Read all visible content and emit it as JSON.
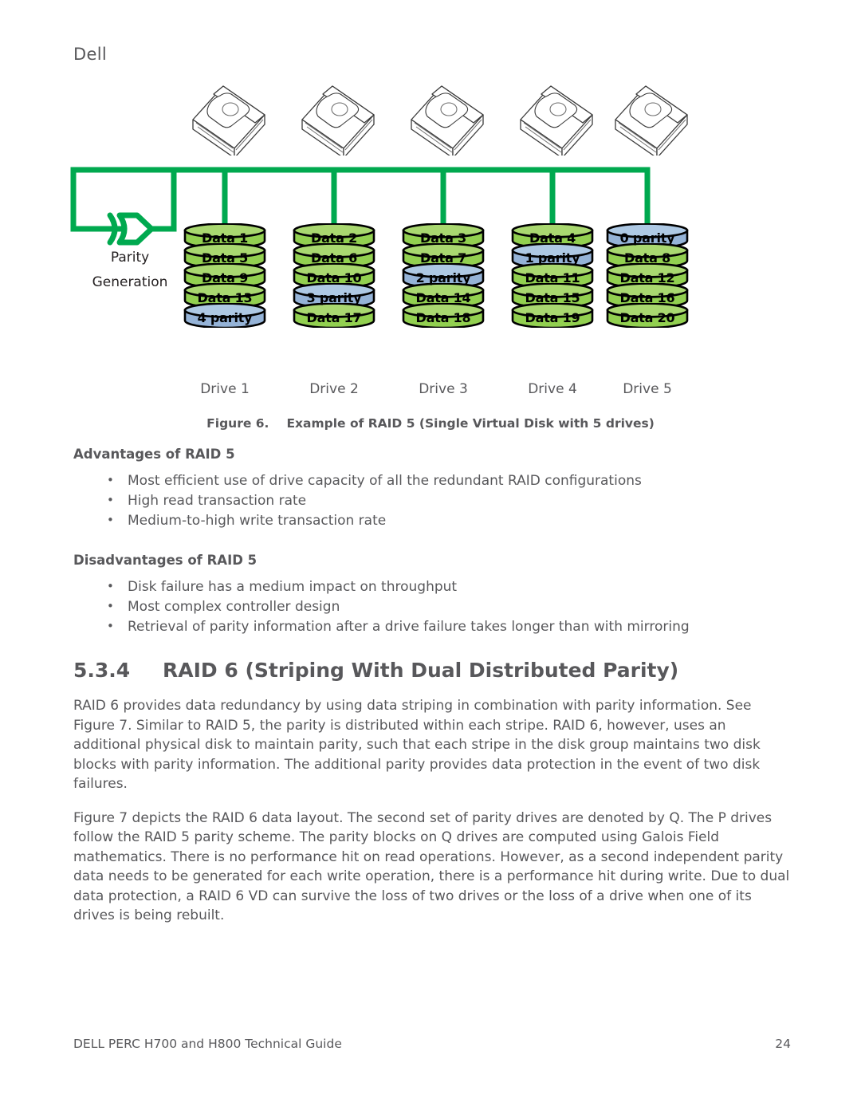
{
  "header": {
    "logo_text": "Dell"
  },
  "figure": {
    "caption_number": "Figure 6.",
    "caption_text": "Example of RAID 5 (Single Virtual Disk with 5 drives)",
    "parity_label_line1": "Parity",
    "parity_label_line2": "Generation",
    "colors": {
      "green_block": "#92D050",
      "green_top": "#A9D870",
      "blue_block": "#95B3D7",
      "blue_top": "#AEC9E4",
      "bus_line": "#00A94F",
      "outline": "#000000"
    },
    "drives": [
      {
        "label": "Drive 1",
        "blocks": [
          {
            "text": "Data 1",
            "kind": "data"
          },
          {
            "text": "Data 5",
            "kind": "data"
          },
          {
            "text": "Data 9",
            "kind": "data"
          },
          {
            "text": "Data 13",
            "kind": "data"
          },
          {
            "text": "4 parity",
            "kind": "parity"
          }
        ]
      },
      {
        "label": "Drive 2",
        "blocks": [
          {
            "text": "Data 2",
            "kind": "data"
          },
          {
            "text": "Data 6",
            "kind": "data"
          },
          {
            "text": "Data 10",
            "kind": "data"
          },
          {
            "text": "3 parity",
            "kind": "parity"
          },
          {
            "text": "Data 17",
            "kind": "data"
          }
        ]
      },
      {
        "label": "Drive 3",
        "blocks": [
          {
            "text": "Data 3",
            "kind": "data"
          },
          {
            "text": "Data 7",
            "kind": "data"
          },
          {
            "text": "2 parity",
            "kind": "parity"
          },
          {
            "text": "Data 14",
            "kind": "data"
          },
          {
            "text": "Data 18",
            "kind": "data"
          }
        ]
      },
      {
        "label": "Drive 4",
        "blocks": [
          {
            "text": "Data 4",
            "kind": "data"
          },
          {
            "text": "1 parity",
            "kind": "parity"
          },
          {
            "text": "Data 11",
            "kind": "data"
          },
          {
            "text": "Data 15",
            "kind": "data"
          },
          {
            "text": "Data 19",
            "kind": "data"
          }
        ]
      },
      {
        "label": "Drive 5",
        "blocks": [
          {
            "text": "0 parity",
            "kind": "parity"
          },
          {
            "text": "Data 8",
            "kind": "data"
          },
          {
            "text": "Data 12",
            "kind": "data"
          },
          {
            "text": "Data 16",
            "kind": "data"
          },
          {
            "text": "Data 20",
            "kind": "data"
          }
        ]
      }
    ]
  },
  "advantages": {
    "heading": "Advantages of RAID 5",
    "items": [
      "Most efficient use of drive capacity of all the redundant RAID configurations",
      "High read transaction rate",
      "Medium-to-high write transaction rate"
    ]
  },
  "disadvantages": {
    "heading": "Disadvantages of RAID 5",
    "items": [
      "Disk failure has a medium impact on throughput",
      "Most complex controller design",
      "Retrieval of parity information after a drive failure takes longer than with mirroring"
    ]
  },
  "section": {
    "number": "5.3.4",
    "title": "RAID 6 (Striping With Dual Distributed Parity)",
    "paragraphs": [
      "RAID 6 provides data redundancy by using data striping in combination with parity information. See Figure 7. Similar to RAID 5, the parity is distributed within each stripe. RAID 6, however, uses an additional physical disk to maintain parity, such that each stripe in the disk group maintains two disk blocks with parity information. The additional parity provides data protection in the event of two disk failures.",
      "Figure 7 depicts the RAID 6 data layout. The second set of parity drives are denoted by Q. The P drives follow the RAID 5 parity scheme. The parity blocks on Q drives are computed using Galois Field mathematics. There is no performance hit on read operations. However, as a second independent parity data needs to be generated for each write operation, there is a performance hit during write. Due to dual data protection, a RAID 6 VD can survive the loss of two drives or the loss of a drive when one of its drives is being rebuilt."
    ]
  },
  "footer": {
    "document_title": "DELL PERC H700 and H800 Technical Guide",
    "page_number": "24"
  }
}
